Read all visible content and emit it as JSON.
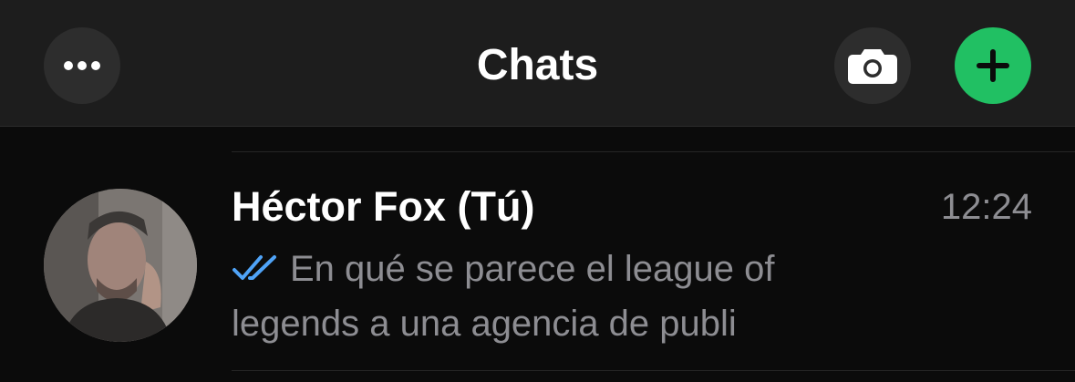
{
  "header": {
    "title": "Chats",
    "more_icon": "ellipsis-icon",
    "camera_icon": "camera-icon",
    "add_icon": "plus-icon",
    "accent_color": "#21c063"
  },
  "chats": [
    {
      "name": "Héctor Fox (Tú)",
      "time": "12:24",
      "status_icon": "double-check-read-icon",
      "status_color": "#4fa3f7",
      "preview": "En qué se parece el league of legends a una agencia de publi"
    }
  ]
}
